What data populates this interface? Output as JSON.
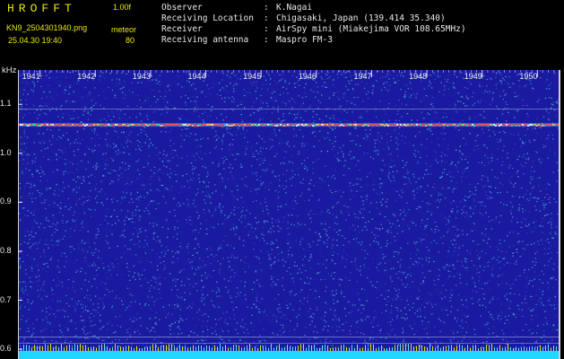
{
  "header": {
    "app_title": "HROFFT",
    "version": "1.00f",
    "filename": "KN9_2504301940.png",
    "mode_label": "meteor",
    "datetime": "25.04.30 19:40",
    "mode_value": "80",
    "info": [
      {
        "key": "Observer",
        "colon": ":",
        "value": "K.Nagai"
      },
      {
        "key": "Receiving Location",
        "colon": ":",
        "value": "Chigasaki, Japan (139.414 35.340)"
      },
      {
        "key": "Receiver",
        "colon": ":",
        "value": "AirSpy mini (Miakejima VOR 108.65MHz)"
      },
      {
        "key": "Receiving antenna",
        "colon": ":",
        "value": "Maspro FM-3"
      }
    ]
  },
  "chart_data": {
    "type": "heatmap",
    "ylabel": "kHz",
    "yticks": [
      "1.1",
      "1.0",
      "0.9",
      "0.8",
      "0.7",
      "0.6"
    ],
    "ytick_values": [
      1.1,
      1.0,
      0.9,
      0.8,
      0.7,
      0.6
    ],
    "ylim": [
      0.58,
      1.17
    ],
    "xticks": [
      "1941",
      "1942",
      "1943",
      "1944",
      "1945",
      "1946",
      "1947",
      "1948",
      "1949",
      "1950"
    ],
    "xlim": [
      1940.6,
      1950.4
    ],
    "carrier_khz": 1.058,
    "reference_lines_khz": [
      1.09,
      0.612,
      0.625
    ],
    "colors": {
      "background": "#1a1aa0",
      "noise": "#4a6ad8",
      "carrier": "#ff5050",
      "baseline": "#20d8ff",
      "text": "#e8e8e8",
      "title": "#e8e800"
    }
  }
}
